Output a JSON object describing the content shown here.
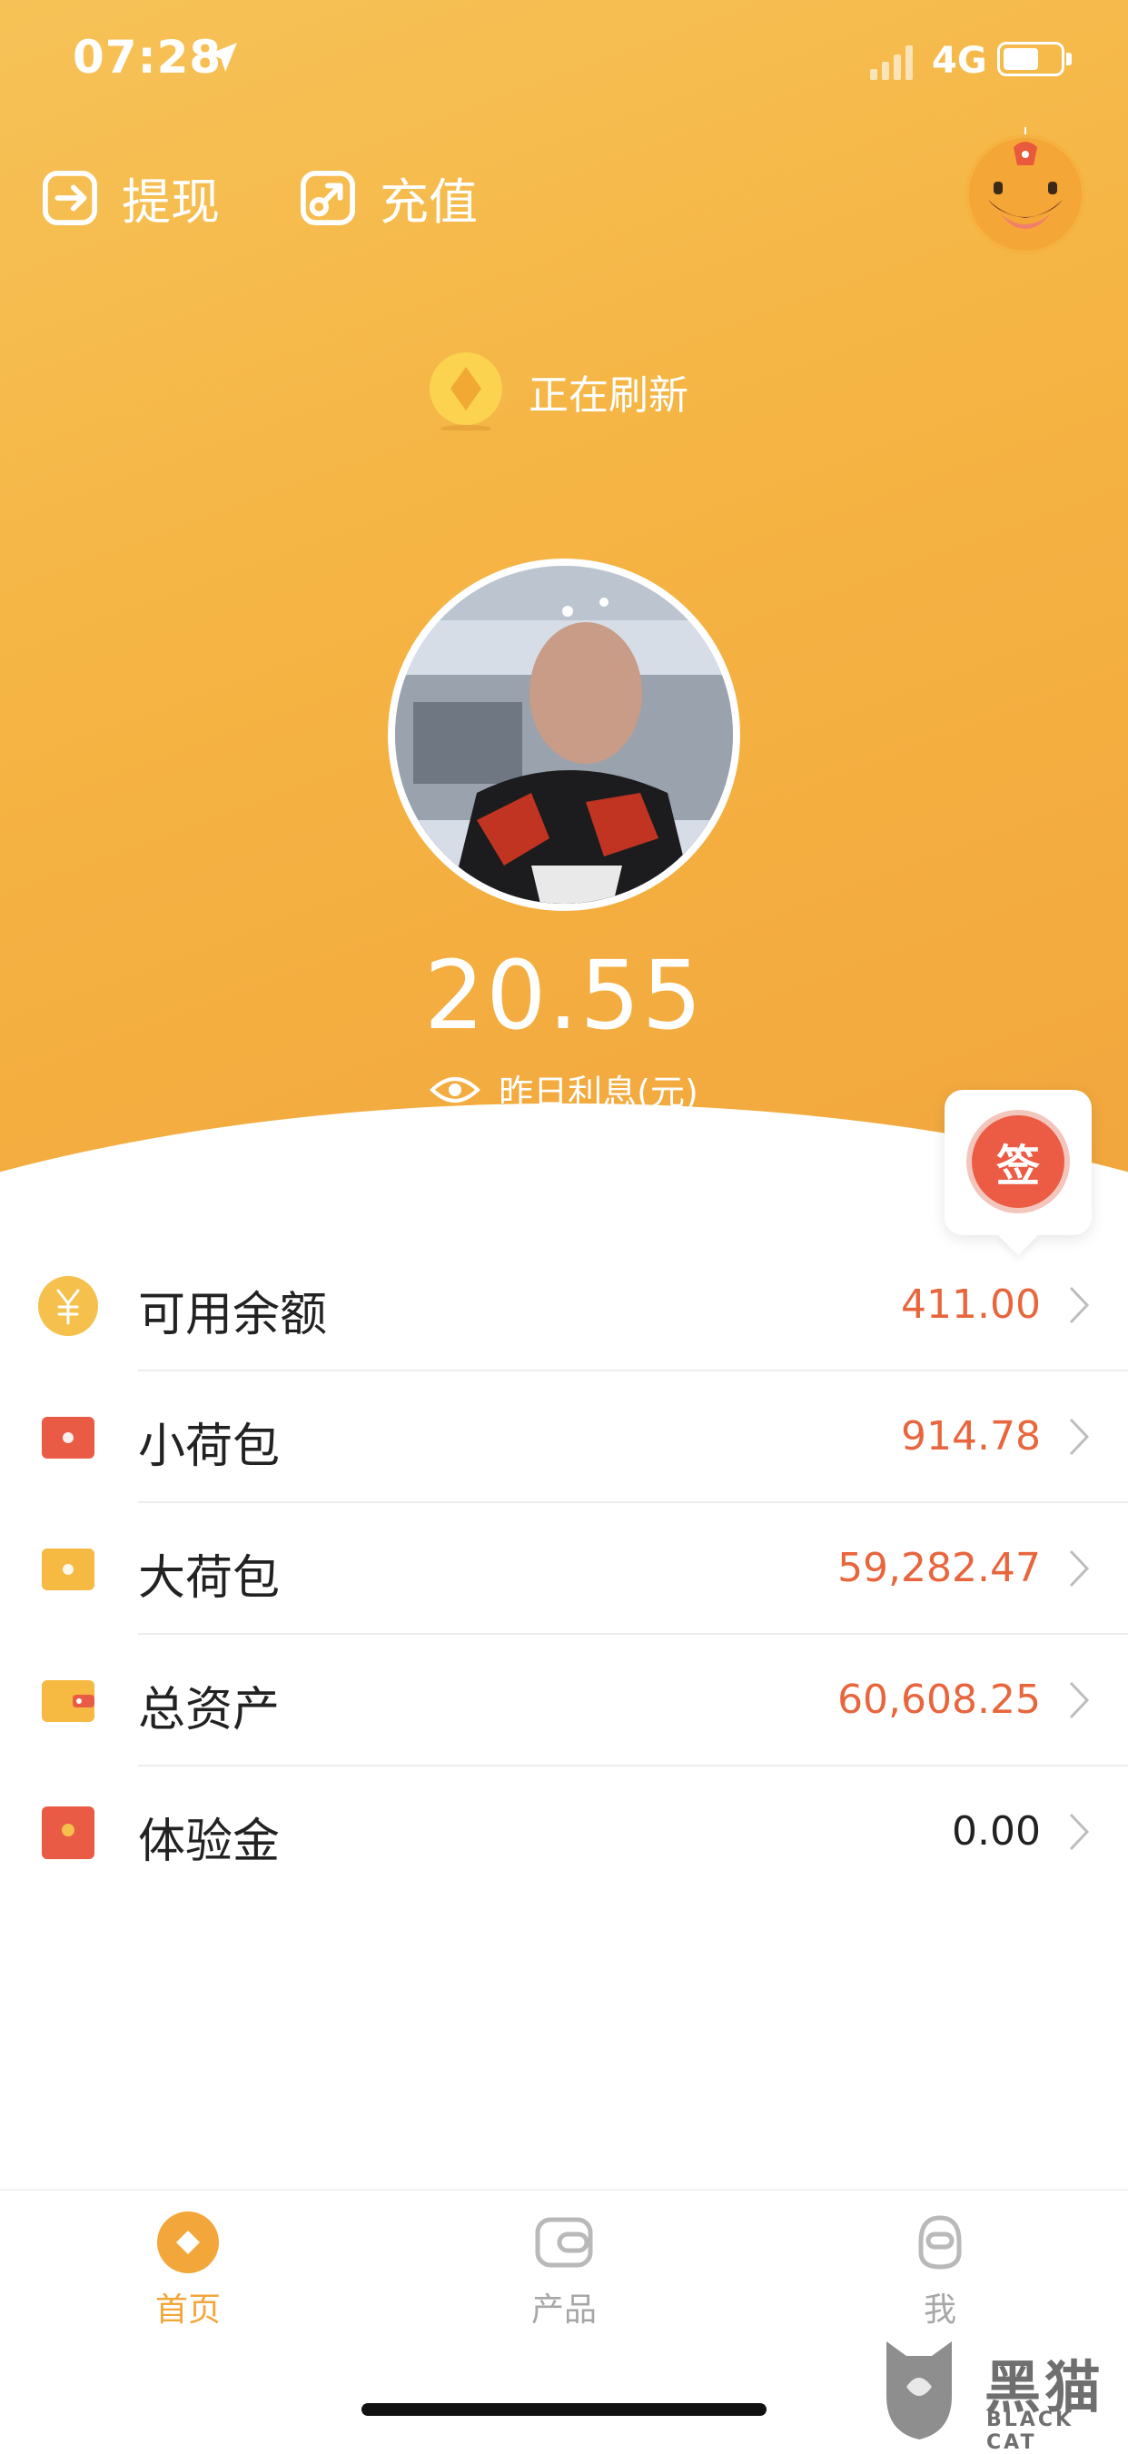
{
  "status_bar": {
    "time": "07:28",
    "network": "4G"
  },
  "top_actions": {
    "withdraw_label": "提现",
    "recharge_label": "充值"
  },
  "refresh_text": "正在刷新",
  "summary": {
    "amount": "20.55",
    "label": "昨日利息(元)"
  },
  "checkin_label": "签",
  "assets": [
    {
      "label": "可用余额",
      "value": "411.00",
      "icon": "yuan-coin-icon",
      "color": "#f6c04c"
    },
    {
      "label": "小荷包",
      "value": "914.78",
      "icon": "red-wallet-icon",
      "color": "#e95b45"
    },
    {
      "label": "大荷包",
      "value": "59,282.47",
      "icon": "yellow-wallet-icon",
      "color": "#f6b942"
    },
    {
      "label": "总资产",
      "value": "60,608.25",
      "icon": "total-wallet-icon",
      "color": "#f6b942"
    },
    {
      "label": "体验金",
      "value": "0.00",
      "icon": "trial-fund-icon",
      "color": "#e95b45"
    }
  ],
  "tabs": [
    {
      "label": "首页",
      "icon": "home-icon",
      "active": true
    },
    {
      "label": "产品",
      "icon": "product-icon",
      "active": false
    },
    {
      "label": "我",
      "icon": "profile-icon",
      "active": false
    }
  ],
  "watermark": {
    "text": "黑猫",
    "subtext": "BLACK CAT"
  },
  "colors": {
    "accent": "#f5b443",
    "value": "#e8663d",
    "tab_active": "#f3a63a"
  }
}
